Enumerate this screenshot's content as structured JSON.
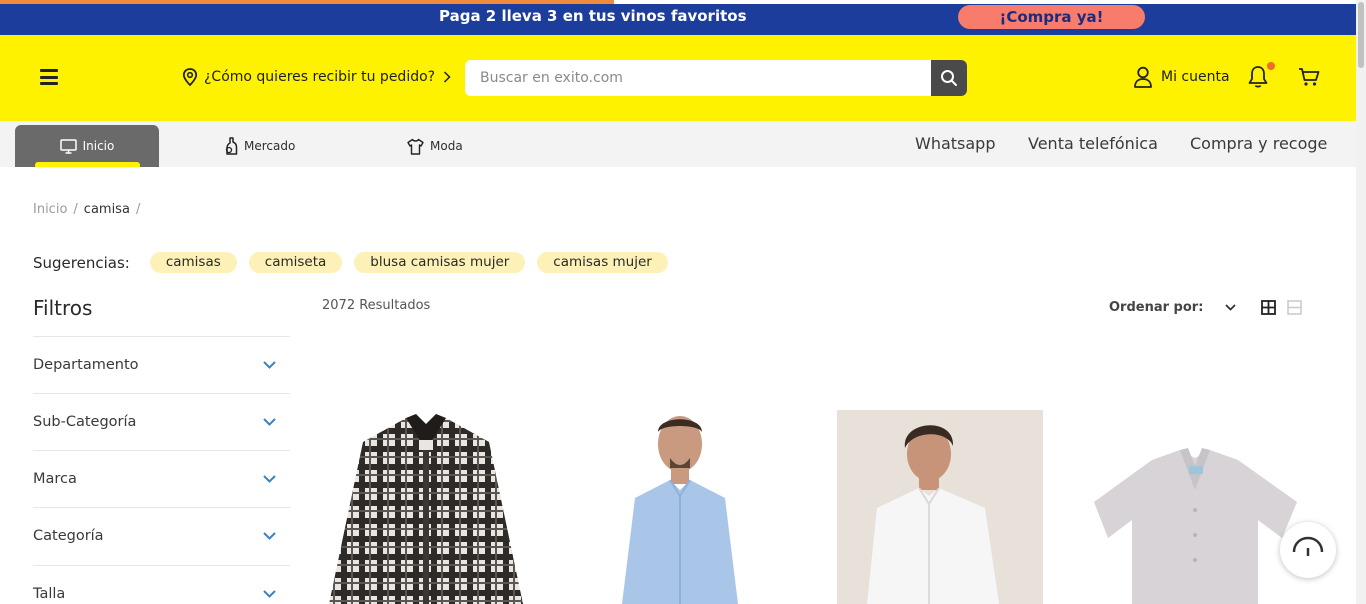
{
  "promo": {
    "message": "Paga 2 lleva 3 en tus vinos favoritos",
    "cta": "¡Compra ya!",
    "progress_fraction": 0.45
  },
  "header": {
    "delivery_label": "¿Cómo quieres recibir tu pedido?",
    "search_placeholder": "Buscar en exito.com",
    "account_label": "Mi cuenta"
  },
  "categories": [
    {
      "label": "Inicio",
      "icon": "monitor-icon",
      "active": true
    },
    {
      "label": "Mercado",
      "icon": "bottle-icon",
      "active": false
    },
    {
      "label": "Moda",
      "icon": "shirt-icon",
      "active": false
    }
  ],
  "quick_links": [
    "Whatsapp",
    "Venta telefónica",
    "Compra y recoge"
  ],
  "breadcrumb": [
    "Inicio",
    "camisa"
  ],
  "suggestions": {
    "label": "Sugerencias:",
    "items": [
      "camisas",
      "camiseta",
      "blusa camisas mujer",
      "camisas mujer"
    ]
  },
  "filters": {
    "title": "Filtros",
    "items": [
      "Departamento",
      "Sub-Categoría",
      "Marca",
      "Categoría",
      "Talla"
    ]
  },
  "results": {
    "count_label": "2072 Resultados",
    "order_label": "Ordenar por:"
  },
  "colors": {
    "promo_bar": "#1c3d9c",
    "header_yellow": "#fff200",
    "cta_bg": "#f87c6b",
    "chip_bg": "#fdf1b8",
    "accent_blue": "#3b82c4"
  }
}
